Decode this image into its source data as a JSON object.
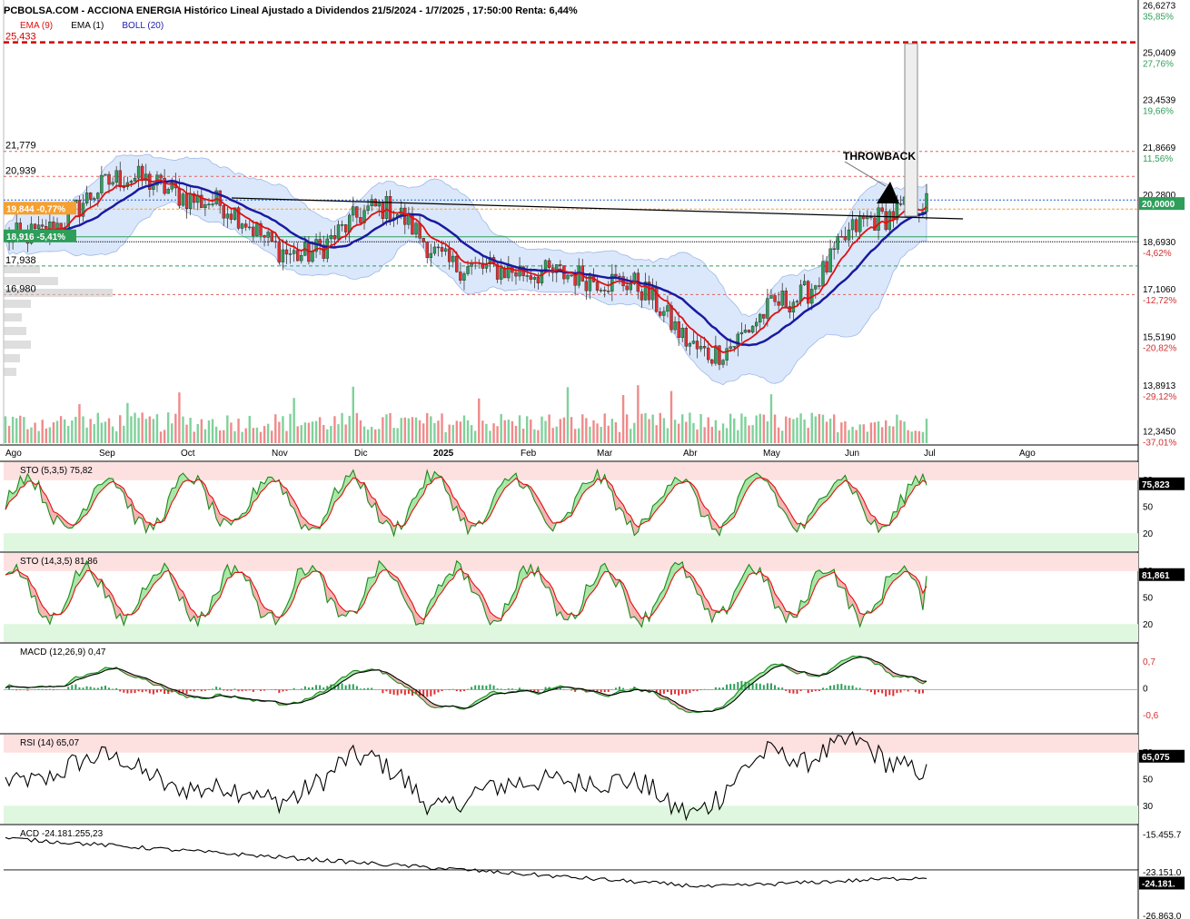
{
  "header": {
    "title": "PCBOLSA.COM - ACCIONA ENERGIA Histórico Lineal Ajustado a Dividendos 21/5/2024 - 1/7/2025 , 17:50:00 Renta: 6,44%",
    "legend": [
      {
        "label": "EMA (9)",
        "color": "#e01010"
      },
      {
        "label": "EMA (1)",
        "color": "#000000"
      },
      {
        "label": "BOLL (20)",
        "color": "#2020b0"
      }
    ]
  },
  "annotation": "THROWBACK",
  "colors": {
    "up": "#2e9e5a",
    "down": "#e03030",
    "ema9": "#e01010",
    "boll": "#1a1aa0",
    "band_fill": "#dbe8fb",
    "stoch_k": "#1a8a1a",
    "stoch_d": "#e01010"
  },
  "chart_data": [
    {
      "type": "candlestick",
      "name_label": "price",
      "x_labels": [
        "Ago",
        "Sep",
        "Oct",
        "Nov",
        "Dic",
        "2025",
        "Feb",
        "Mar",
        "Abr",
        "May",
        "Jun",
        "Jul",
        "Ago"
      ],
      "y_ticks": [
        {
          "value": "26,6273",
          "pct": "35,85%"
        },
        {
          "value": "25,0409",
          "pct": "27,76%"
        },
        {
          "value": "23,4539",
          "pct": "19,66%"
        },
        {
          "value": "21,8669",
          "pct": "11,56%"
        },
        {
          "value": "20,2800",
          "pct": ""
        },
        {
          "value": "18,6930",
          "pct": "-4,62%"
        },
        {
          "value": "17,1060",
          "pct": "-12,72%"
        },
        {
          "value": "15,5190",
          "pct": "-20,82%"
        },
        {
          "value": "13,8913",
          "pct": "-29,12%"
        },
        {
          "value": "12,3450",
          "pct": "-37,01%"
        }
      ],
      "level_labels": [
        {
          "value": "25,433",
          "style": "red-dashed-thick"
        },
        {
          "value": "21,779",
          "style": "red-dashed"
        },
        {
          "value": "20,939",
          "style": "red-dashed"
        },
        {
          "value": "17,938",
          "style": "green-dashed"
        },
        {
          "value": "16,980",
          "style": "red-dashed"
        }
      ],
      "price_tags": [
        {
          "value": "19,844",
          "pct": "-0,77%",
          "color": "#f5a030"
        },
        {
          "value": "18,916",
          "pct": "-5,41%",
          "color": "#2e9e5a"
        }
      ],
      "last_value": "20,0000",
      "ylim": [
        12.0,
        26.7
      ],
      "trendline": "descending neckline from Oct to Jul",
      "monthly_close": [
        {
          "m": "Ago",
          "v": 19.0
        },
        {
          "m": "Sep",
          "v": 20.9
        },
        {
          "m": "Oct",
          "v": 20.1
        },
        {
          "m": "Nov",
          "v": 18.3
        },
        {
          "m": "Dic",
          "v": 19.9
        },
        {
          "m": "2025",
          "v": 17.9
        },
        {
          "m": "Feb",
          "v": 17.7
        },
        {
          "m": "Mar",
          "v": 17.4
        },
        {
          "m": "Abr",
          "v": 15.0
        },
        {
          "m": "May",
          "v": 16.8
        },
        {
          "m": "Jun",
          "v": 19.5
        },
        {
          "m": "Jul",
          "v": 20.0
        }
      ]
    },
    {
      "type": "line",
      "label": "STO (5,3,5)",
      "value": "75,82",
      "last": "75,823",
      "ticks": [
        "80",
        "50",
        "20"
      ]
    },
    {
      "type": "line",
      "label": "STO (14,3,5)",
      "value": "81,86",
      "last": "81,861",
      "ticks": [
        "80",
        "50",
        "20"
      ]
    },
    {
      "type": "line",
      "label": "MACD (12,26,9)",
      "value": "0,47",
      "ticks": [
        "0,7",
        "0",
        "-0,6"
      ]
    },
    {
      "type": "line",
      "label": "RSI (14)",
      "value": "65,07",
      "last": "65,075",
      "ticks": [
        "70",
        "50",
        "30"
      ]
    },
    {
      "type": "line",
      "label": "ACD",
      "value": "-24.181.255,23",
      "last": "-24.181.",
      "ticks": [
        "-15.455.7",
        "-23.151.0",
        "-26.863.0"
      ]
    }
  ]
}
